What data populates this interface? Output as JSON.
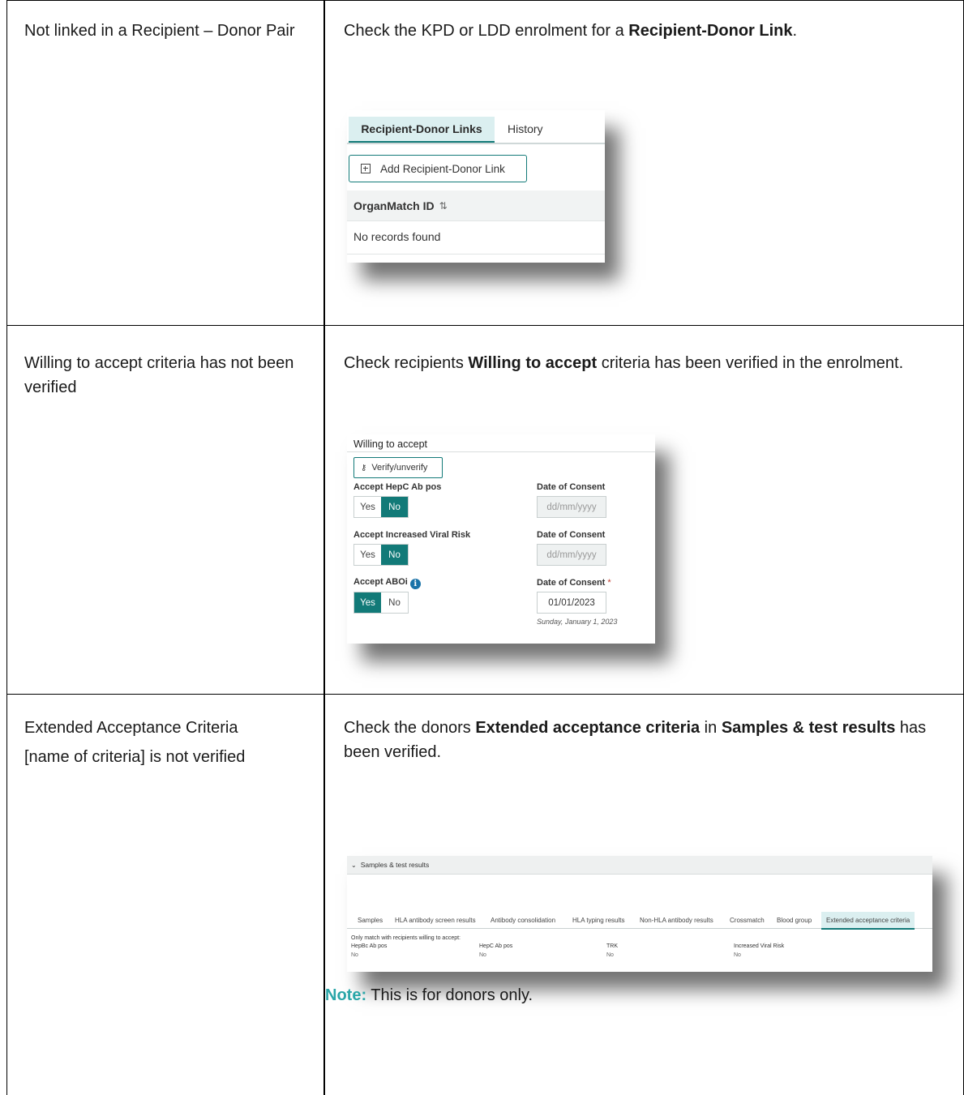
{
  "rows": [
    {
      "issue": "Not linked in a Recipient – Donor Pair",
      "action_pre": "Check the KPD or LDD enrolment for a ",
      "action_bold": "Recipient-Donor Link",
      "action_post": "."
    },
    {
      "issue": "Willing to accept criteria has not been verified",
      "action_pre": "Check recipients ",
      "action_bold": "Willing to accept",
      "action_post": " criteria has been verified in the enrolment."
    },
    {
      "issue_line1": "Extended Acceptance Criteria",
      "issue_line2": "[name of criteria] is not verified",
      "action_pre": "Check the donors ",
      "action_bold1": "Extended acceptance criteria",
      "action_mid": " in ",
      "action_bold2": "Samples & test results",
      "action_post": " has been verified."
    }
  ],
  "card1": {
    "tab_active": "Recipient-Donor Links",
    "tab_other": "History",
    "add_button": "Add Recipient-Donor Link",
    "column_header": "OrganMatch ID",
    "sort_icon": "⇅",
    "empty_text": "No records found"
  },
  "card2": {
    "section_title": "Willing to accept",
    "verify_button": "Verify/unverify",
    "fields": [
      {
        "label": "Accept HepC Ab pos",
        "yes": "Yes",
        "no": "No",
        "selected": "No",
        "date_label": "Date of Consent",
        "date_value": "dd/mm/yyyy"
      },
      {
        "label": "Accept Increased Viral Risk",
        "yes": "Yes",
        "no": "No",
        "selected": "No",
        "date_label": "Date of Consent",
        "date_value": "dd/mm/yyyy"
      },
      {
        "label": "Accept ABOi",
        "yes": "Yes",
        "no": "No",
        "selected": "Yes",
        "date_label": "Date of Consent",
        "required_mark": "*",
        "date_value": "01/01/2023",
        "date_help": "Sunday, January 1, 2023"
      }
    ]
  },
  "card3": {
    "section_title": "Samples & test results",
    "tabs": [
      "Samples",
      "HLA antibody screen results",
      "Antibody consolidation",
      "HLA typing results",
      "Non-HLA antibody results",
      "Crossmatch",
      "Blood group",
      "Extended acceptance criteria"
    ],
    "active_tab": "Extended acceptance criteria",
    "intro": "Only match with recipients willing to accept:",
    "criteria": [
      {
        "label": "HepBc Ab pos",
        "value": "No"
      },
      {
        "label": "HepC Ab pos",
        "value": "No"
      },
      {
        "label": "TRK",
        "value": "No"
      },
      {
        "label": "Increased Viral Risk",
        "value": "No"
      }
    ]
  },
  "note": {
    "label": "Note:",
    "text": " This is for donors only."
  },
  "colors": {
    "accent_teal": "#127a78",
    "active_tab_bg": "#dbeff0",
    "note_label": "#2aa6a8",
    "info_icon": "#1a73a8"
  }
}
